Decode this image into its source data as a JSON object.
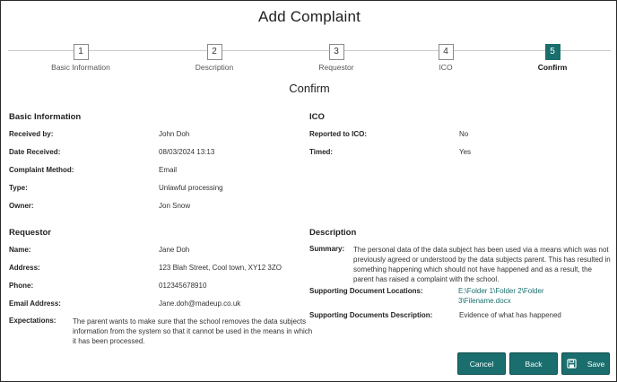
{
  "page": {
    "title": "Add Complaint",
    "section_title": "Confirm"
  },
  "stepper": {
    "steps": [
      {
        "number": "1",
        "label": "Basic Information"
      },
      {
        "number": "2",
        "label": "Description"
      },
      {
        "number": "3",
        "label": "Requestor"
      },
      {
        "number": "4",
        "label": "ICO"
      },
      {
        "number": "5",
        "label": "Confirm"
      }
    ]
  },
  "basic_information": {
    "heading": "Basic Information",
    "rows": [
      {
        "label": "Received by:",
        "value": "John Doh"
      },
      {
        "label": "Date Received:",
        "value": "08/03/2024 13:13"
      },
      {
        "label": "Complaint Method:",
        "value": "Email"
      },
      {
        "label": "Type:",
        "value": "Unlawful processing"
      },
      {
        "label": "Owner:",
        "value": "Jon Snow"
      }
    ]
  },
  "ico": {
    "heading": "ICO",
    "rows": [
      {
        "label": "Reported to ICO:",
        "value": "No"
      },
      {
        "label": "Timed:",
        "value": "Yes"
      }
    ]
  },
  "requestor": {
    "heading": "Requestor",
    "rows": [
      {
        "label": "Name:",
        "value": "Jane Doh"
      },
      {
        "label": "Address:",
        "value": "123 Blah Street, Cool town, XY12 3ZO"
      },
      {
        "label": "Phone:",
        "value": "012345678910"
      },
      {
        "label": "Email Address:",
        "value": "Jane.doh@madeup.co.uk"
      }
    ],
    "expectations_label": "Expectations:",
    "expectations_value": "The parent wants to make sure that the school removes the data subjects information from the system so that it cannot be used in the means in which it has been processed."
  },
  "description": {
    "heading": "Description",
    "summary_label": "Summary:",
    "summary_value": "The personal data of the data subject has been used via a means which was not previously agreed or understood by the data subjects parent. This has resulted in something happening which should not have happened and as a result, the parent has raised a complaint with the school.",
    "locations_label": "Supporting Document Locations:",
    "locations_value": "E:\\Folder 1\\Folder 2\\Folder 3\\Filename.docx",
    "doc_desc_label": "Supporting Documents Description:",
    "doc_desc_value": "Evidence of what has happened"
  },
  "buttons": {
    "cancel": "Cancel",
    "back": "Back",
    "save": "Save"
  },
  "icons": {
    "save": "save-icon"
  },
  "colors": {
    "accent": "#1b6e6e"
  }
}
